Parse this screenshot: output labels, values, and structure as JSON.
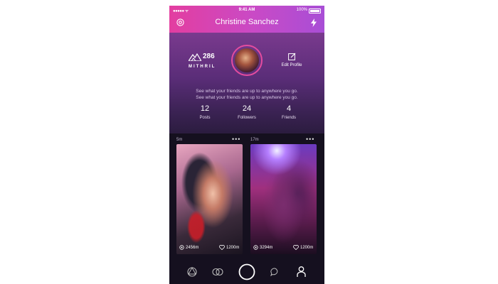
{
  "status_bar": {
    "carrier": "●●●●● ᯤ",
    "time": "9:41 AM",
    "battery": "100%"
  },
  "nav": {
    "title": "Christine Sanchez"
  },
  "profile": {
    "rank_count": "286",
    "rank_name": "MITHRIL",
    "edit_label": "Edit Profile",
    "bio_line1": "See what your friends are up to anywhere you go.",
    "bio_line2": "See what your friends are up to anywhere you go."
  },
  "stats": [
    {
      "value": "12",
      "label": "Posts"
    },
    {
      "value": "24",
      "label": "Followers"
    },
    {
      "value": "4",
      "label": "Friends"
    }
  ],
  "posts": [
    {
      "age": "5m",
      "more": "•••",
      "views": "2456m",
      "likes": "1200m"
    },
    {
      "age": "17m",
      "more": "•••",
      "views": "3294m",
      "likes": "1200m"
    }
  ],
  "colors": {
    "accent_pink": "#e33ea0",
    "accent_purple": "#a84ed6",
    "background": "#1d1630"
  },
  "icons": [
    "gear-icon",
    "flash-icon",
    "mountain-icon",
    "edit-icon",
    "eye-icon",
    "heart-icon",
    "ring-icon",
    "link-icon",
    "camera-icon",
    "chat-icon",
    "profile-icon"
  ]
}
